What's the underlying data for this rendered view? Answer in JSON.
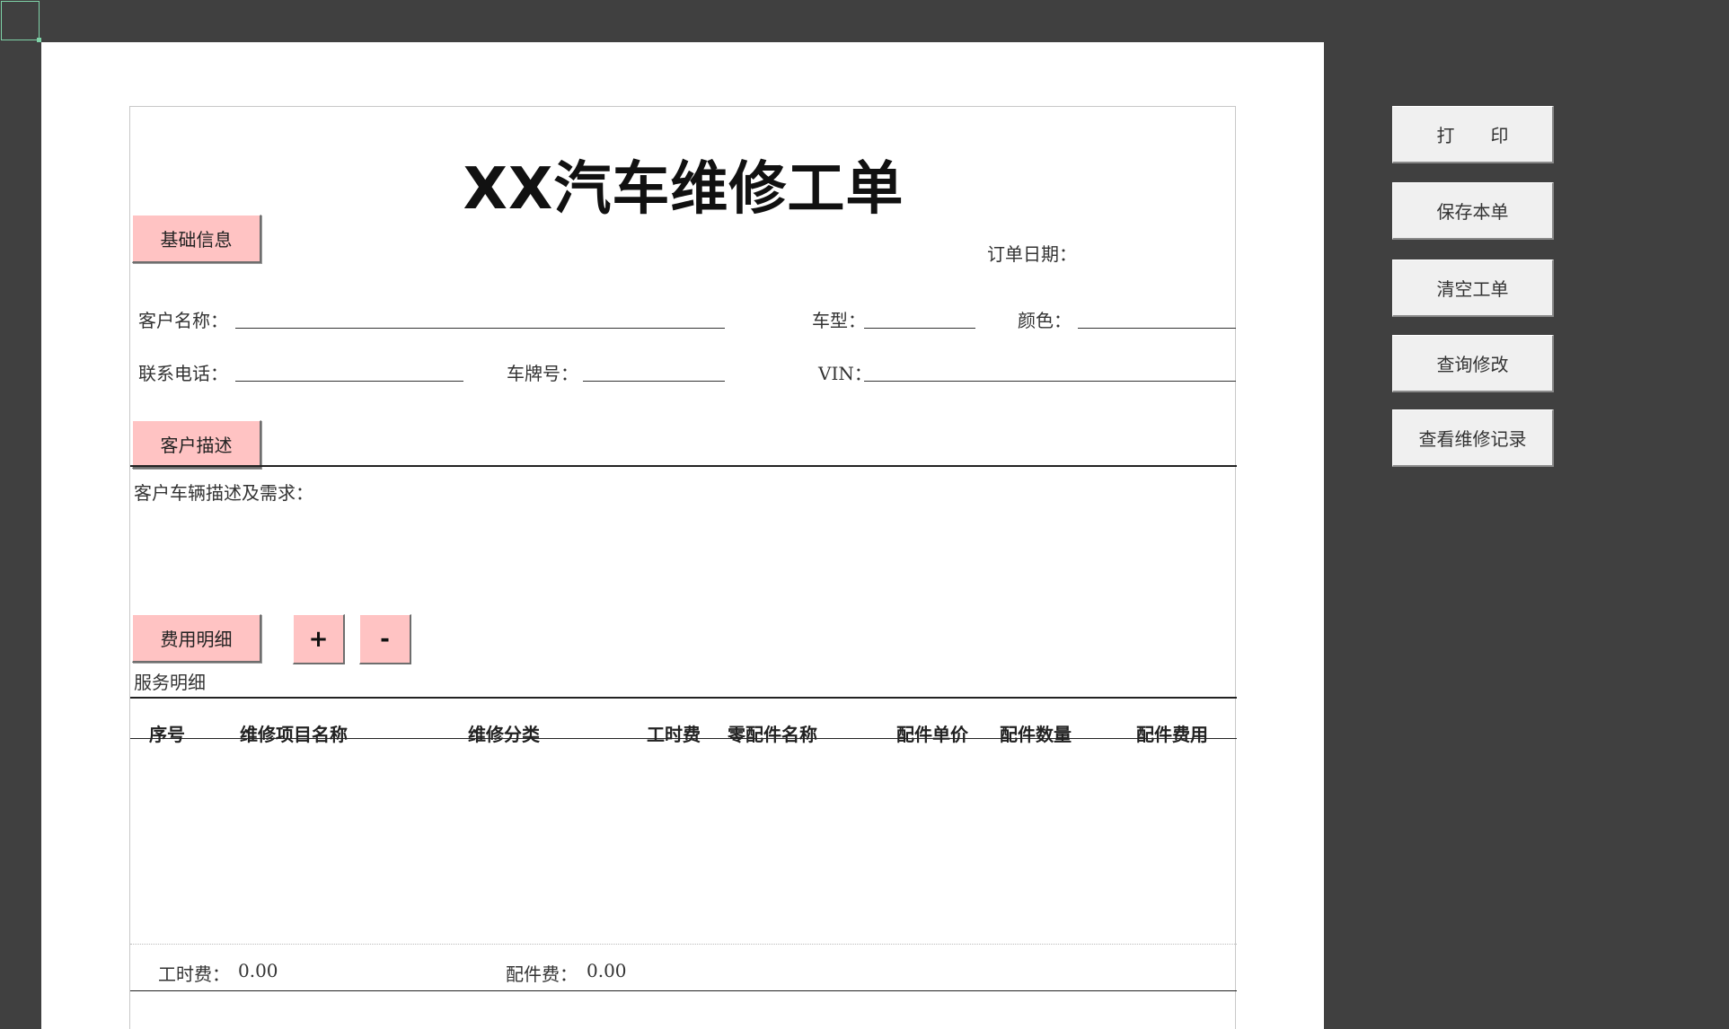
{
  "form": {
    "title": "XX汽车维修工单",
    "section_basic_label": "基础信息",
    "order_date_label": "订单日期：",
    "customer_name_label": "客户名称：",
    "car_model_label": "车型：",
    "color_label": "颜色：",
    "phone_label": "联系电话：",
    "plate_label": "车牌号：",
    "vin_label": "VIN：",
    "section_desc_label": "客户描述",
    "desc_prompt": "客户车辆描述及需求：",
    "section_cost_label": "费用明细",
    "add_row_label": "+",
    "remove_row_label": "-",
    "service_detail_label": "服务明细",
    "table_headers": [
      "序号",
      "维修项目名称",
      "维修分类",
      "工时费",
      "零配件名称",
      "配件单价",
      "配件数量",
      "配件费用"
    ],
    "labor_fee_label": "工时费：",
    "labor_fee_value": "0.00",
    "parts_fee_label": "配件费：",
    "parts_fee_value": "0.00"
  },
  "side_buttons": {
    "print": "打　　印",
    "save": "保存本单",
    "clear": "清空工单",
    "query": "查询修改",
    "records": "查看维修记录"
  }
}
